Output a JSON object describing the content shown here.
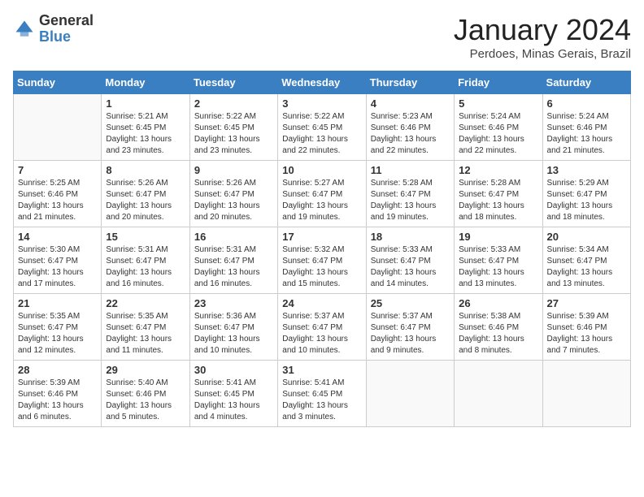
{
  "logo": {
    "general": "General",
    "blue": "Blue"
  },
  "header": {
    "month": "January 2024",
    "location": "Perdoes, Minas Gerais, Brazil"
  },
  "days_of_week": [
    "Sunday",
    "Monday",
    "Tuesday",
    "Wednesday",
    "Thursday",
    "Friday",
    "Saturday"
  ],
  "weeks": [
    [
      {
        "day": "",
        "empty": true
      },
      {
        "day": "1",
        "sunrise": "Sunrise: 5:21 AM",
        "sunset": "Sunset: 6:45 PM",
        "daylight": "Daylight: 13 hours and 23 minutes."
      },
      {
        "day": "2",
        "sunrise": "Sunrise: 5:22 AM",
        "sunset": "Sunset: 6:45 PM",
        "daylight": "Daylight: 13 hours and 23 minutes."
      },
      {
        "day": "3",
        "sunrise": "Sunrise: 5:22 AM",
        "sunset": "Sunset: 6:45 PM",
        "daylight": "Daylight: 13 hours and 22 minutes."
      },
      {
        "day": "4",
        "sunrise": "Sunrise: 5:23 AM",
        "sunset": "Sunset: 6:46 PM",
        "daylight": "Daylight: 13 hours and 22 minutes."
      },
      {
        "day": "5",
        "sunrise": "Sunrise: 5:24 AM",
        "sunset": "Sunset: 6:46 PM",
        "daylight": "Daylight: 13 hours and 22 minutes."
      },
      {
        "day": "6",
        "sunrise": "Sunrise: 5:24 AM",
        "sunset": "Sunset: 6:46 PM",
        "daylight": "Daylight: 13 hours and 21 minutes."
      }
    ],
    [
      {
        "day": "7",
        "sunrise": "Sunrise: 5:25 AM",
        "sunset": "Sunset: 6:46 PM",
        "daylight": "Daylight: 13 hours and 21 minutes."
      },
      {
        "day": "8",
        "sunrise": "Sunrise: 5:26 AM",
        "sunset": "Sunset: 6:47 PM",
        "daylight": "Daylight: 13 hours and 20 minutes."
      },
      {
        "day": "9",
        "sunrise": "Sunrise: 5:26 AM",
        "sunset": "Sunset: 6:47 PM",
        "daylight": "Daylight: 13 hours and 20 minutes."
      },
      {
        "day": "10",
        "sunrise": "Sunrise: 5:27 AM",
        "sunset": "Sunset: 6:47 PM",
        "daylight": "Daylight: 13 hours and 19 minutes."
      },
      {
        "day": "11",
        "sunrise": "Sunrise: 5:28 AM",
        "sunset": "Sunset: 6:47 PM",
        "daylight": "Daylight: 13 hours and 19 minutes."
      },
      {
        "day": "12",
        "sunrise": "Sunrise: 5:28 AM",
        "sunset": "Sunset: 6:47 PM",
        "daylight": "Daylight: 13 hours and 18 minutes."
      },
      {
        "day": "13",
        "sunrise": "Sunrise: 5:29 AM",
        "sunset": "Sunset: 6:47 PM",
        "daylight": "Daylight: 13 hours and 18 minutes."
      }
    ],
    [
      {
        "day": "14",
        "sunrise": "Sunrise: 5:30 AM",
        "sunset": "Sunset: 6:47 PM",
        "daylight": "Daylight: 13 hours and 17 minutes."
      },
      {
        "day": "15",
        "sunrise": "Sunrise: 5:31 AM",
        "sunset": "Sunset: 6:47 PM",
        "daylight": "Daylight: 13 hours and 16 minutes."
      },
      {
        "day": "16",
        "sunrise": "Sunrise: 5:31 AM",
        "sunset": "Sunset: 6:47 PM",
        "daylight": "Daylight: 13 hours and 16 minutes."
      },
      {
        "day": "17",
        "sunrise": "Sunrise: 5:32 AM",
        "sunset": "Sunset: 6:47 PM",
        "daylight": "Daylight: 13 hours and 15 minutes."
      },
      {
        "day": "18",
        "sunrise": "Sunrise: 5:33 AM",
        "sunset": "Sunset: 6:47 PM",
        "daylight": "Daylight: 13 hours and 14 minutes."
      },
      {
        "day": "19",
        "sunrise": "Sunrise: 5:33 AM",
        "sunset": "Sunset: 6:47 PM",
        "daylight": "Daylight: 13 hours and 13 minutes."
      },
      {
        "day": "20",
        "sunrise": "Sunrise: 5:34 AM",
        "sunset": "Sunset: 6:47 PM",
        "daylight": "Daylight: 13 hours and 13 minutes."
      }
    ],
    [
      {
        "day": "21",
        "sunrise": "Sunrise: 5:35 AM",
        "sunset": "Sunset: 6:47 PM",
        "daylight": "Daylight: 13 hours and 12 minutes."
      },
      {
        "day": "22",
        "sunrise": "Sunrise: 5:35 AM",
        "sunset": "Sunset: 6:47 PM",
        "daylight": "Daylight: 13 hours and 11 minutes."
      },
      {
        "day": "23",
        "sunrise": "Sunrise: 5:36 AM",
        "sunset": "Sunset: 6:47 PM",
        "daylight": "Daylight: 13 hours and 10 minutes."
      },
      {
        "day": "24",
        "sunrise": "Sunrise: 5:37 AM",
        "sunset": "Sunset: 6:47 PM",
        "daylight": "Daylight: 13 hours and 10 minutes."
      },
      {
        "day": "25",
        "sunrise": "Sunrise: 5:37 AM",
        "sunset": "Sunset: 6:47 PM",
        "daylight": "Daylight: 13 hours and 9 minutes."
      },
      {
        "day": "26",
        "sunrise": "Sunrise: 5:38 AM",
        "sunset": "Sunset: 6:46 PM",
        "daylight": "Daylight: 13 hours and 8 minutes."
      },
      {
        "day": "27",
        "sunrise": "Sunrise: 5:39 AM",
        "sunset": "Sunset: 6:46 PM",
        "daylight": "Daylight: 13 hours and 7 minutes."
      }
    ],
    [
      {
        "day": "28",
        "sunrise": "Sunrise: 5:39 AM",
        "sunset": "Sunset: 6:46 PM",
        "daylight": "Daylight: 13 hours and 6 minutes."
      },
      {
        "day": "29",
        "sunrise": "Sunrise: 5:40 AM",
        "sunset": "Sunset: 6:46 PM",
        "daylight": "Daylight: 13 hours and 5 minutes."
      },
      {
        "day": "30",
        "sunrise": "Sunrise: 5:41 AM",
        "sunset": "Sunset: 6:45 PM",
        "daylight": "Daylight: 13 hours and 4 minutes."
      },
      {
        "day": "31",
        "sunrise": "Sunrise: 5:41 AM",
        "sunset": "Sunset: 6:45 PM",
        "daylight": "Daylight: 13 hours and 3 minutes."
      },
      {
        "day": "",
        "empty": true
      },
      {
        "day": "",
        "empty": true
      },
      {
        "day": "",
        "empty": true
      }
    ]
  ]
}
